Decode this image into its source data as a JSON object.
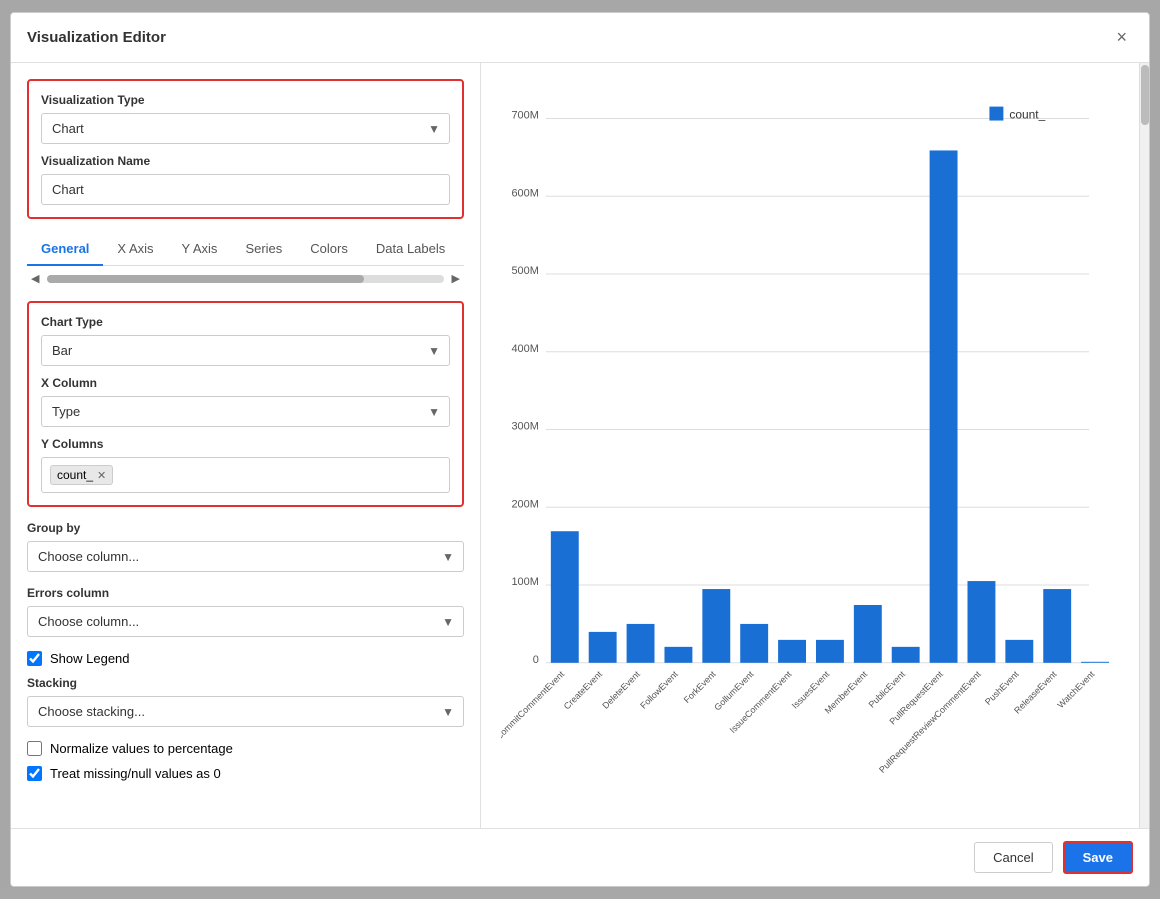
{
  "modal": {
    "title": "Visualization Editor",
    "close_label": "×"
  },
  "left": {
    "viz_type_label": "Visualization Type",
    "viz_type_value": "Chart",
    "viz_name_label": "Visualization Name",
    "viz_name_value": "Chart",
    "tabs": [
      {
        "label": "General",
        "active": true
      },
      {
        "label": "X Axis",
        "active": false
      },
      {
        "label": "Y Axis",
        "active": false
      },
      {
        "label": "Series",
        "active": false
      },
      {
        "label": "Colors",
        "active": false
      },
      {
        "label": "Data Labels",
        "active": false
      }
    ],
    "chart_type_label": "Chart Type",
    "chart_type_value": "Bar",
    "x_column_label": "X Column",
    "x_column_value": "Type",
    "y_columns_label": "Y Columns",
    "y_columns_tag": "count_",
    "group_by_label": "Group by",
    "group_by_placeholder": "Choose column...",
    "errors_column_label": "Errors column",
    "errors_column_placeholder": "Choose column...",
    "show_legend_label": "Show Legend",
    "stacking_label": "Stacking",
    "stacking_placeholder": "Choose stacking...",
    "normalize_label": "Normalize values to percentage",
    "treat_missing_label": "Treat missing/null values as 0"
  },
  "chart": {
    "legend_label": "count_",
    "y_axis_labels": [
      "0",
      "100M",
      "200M",
      "300M",
      "400M",
      "500M",
      "600M",
      "700M"
    ],
    "x_labels": [
      "CommitCommentEvent",
      "CreateEvent",
      "DeleteEvent",
      "FollowEvent",
      "ForkEvent",
      "GollumEvent",
      "IssueCommentEvent",
      "IssuesEvent",
      "MemberEvent",
      "PublicEvent",
      "PullRequestEvent",
      "PullRequestReviewCommentEvent",
      "PushEvent",
      "ReleaseEvent",
      "WatchEvent"
    ],
    "bar_values": [
      170,
      40,
      50,
      20,
      95,
      50,
      30,
      30,
      75,
      20,
      660,
      105,
      30,
      95,
      0
    ]
  },
  "footer": {
    "cancel_label": "Cancel",
    "save_label": "Save"
  }
}
